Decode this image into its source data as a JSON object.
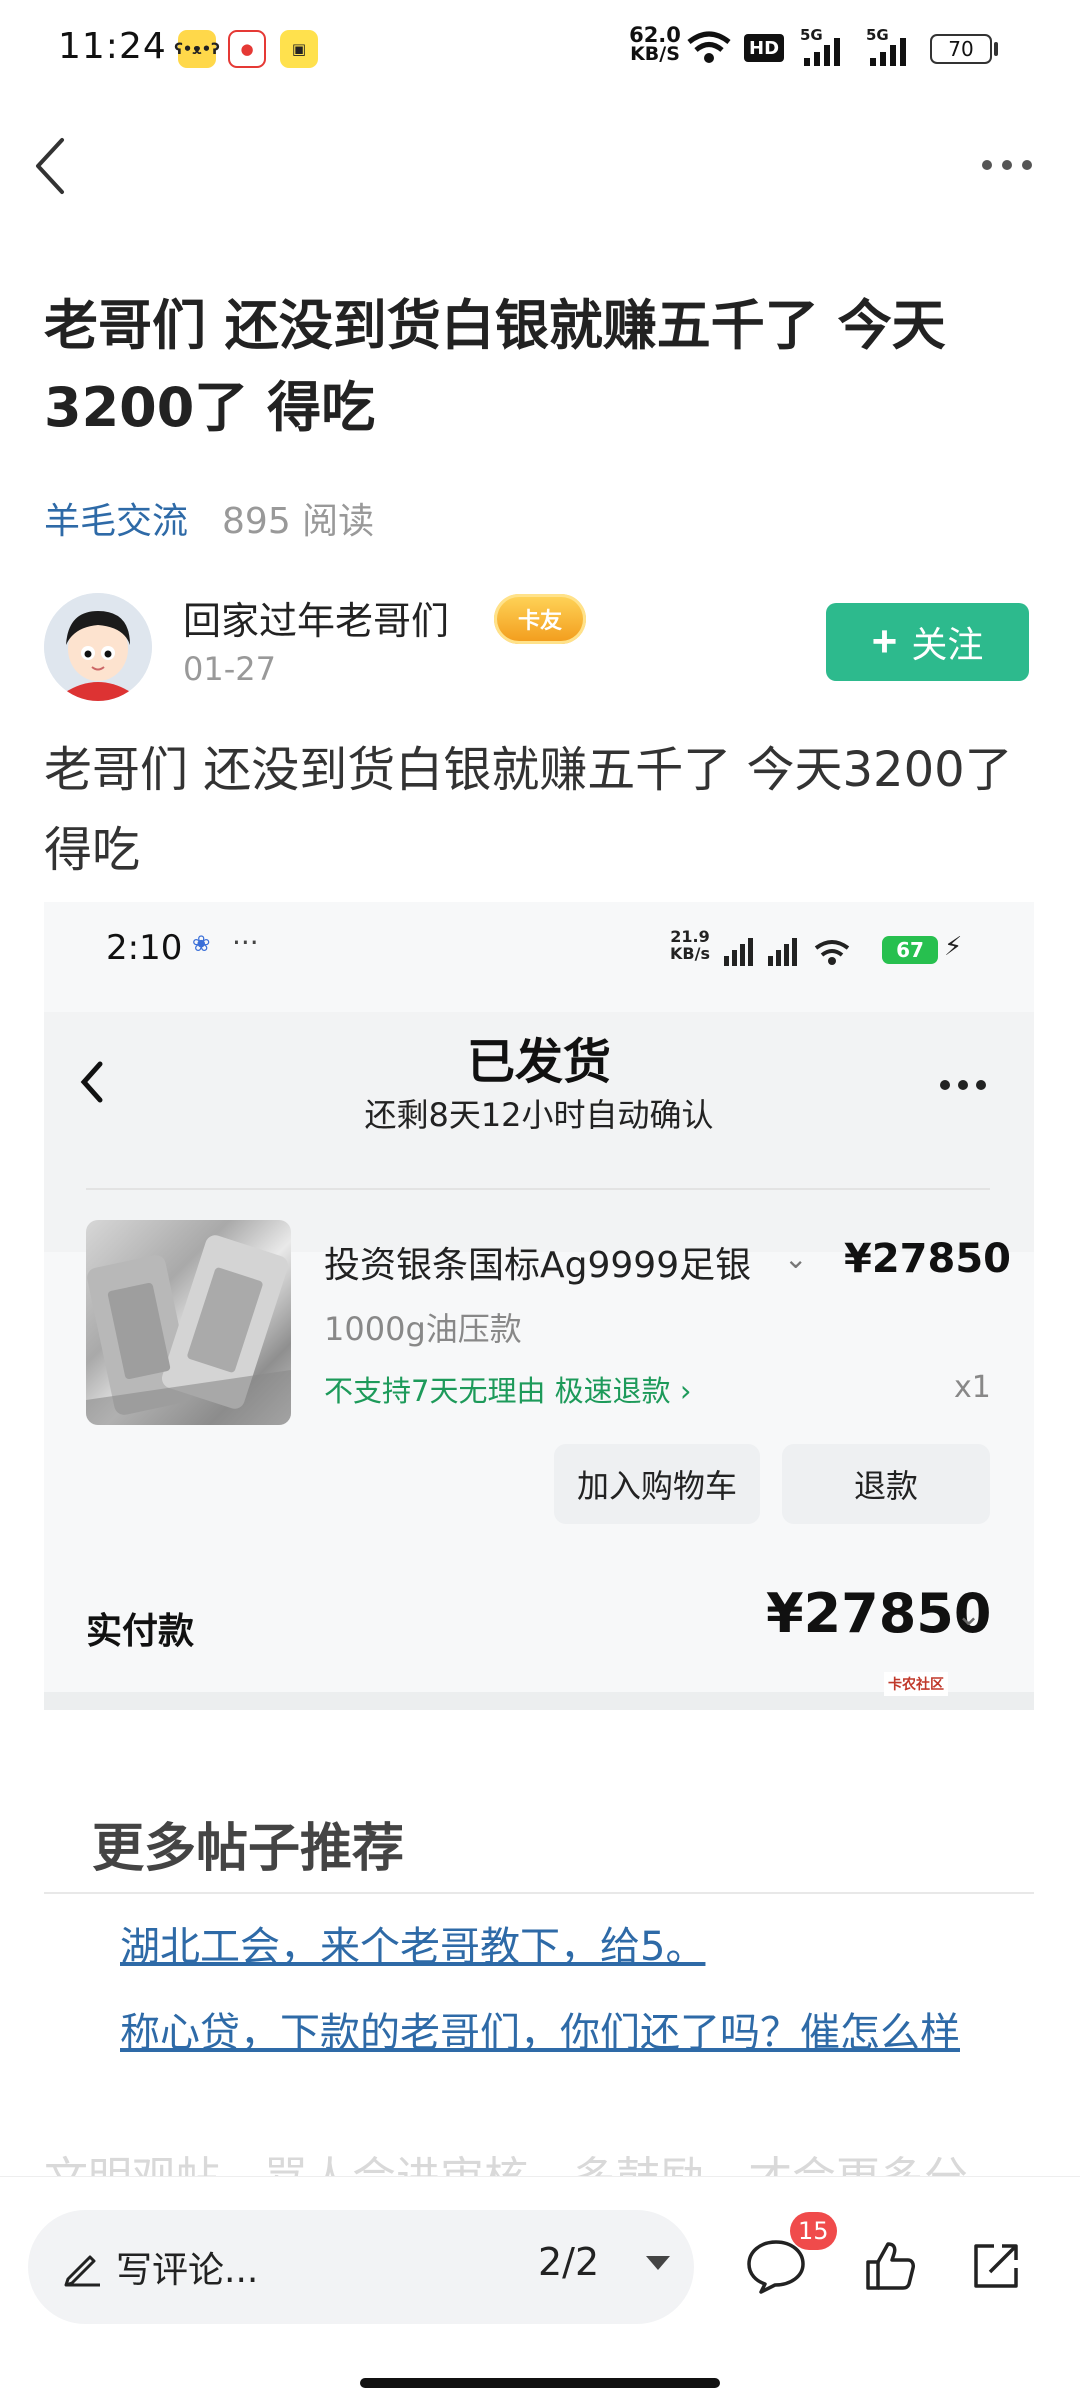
{
  "status_bar": {
    "time": "11:24",
    "net_speed_value": "62.0",
    "net_speed_unit": "KB/S",
    "hd_label": "HD",
    "network_1": "5G",
    "network_2": "5G",
    "battery": "70"
  },
  "post": {
    "title": "老哥们 还没到货白银就赚五千了 今天3200了 得吃",
    "category": "羊毛交流",
    "reads": "895 阅读",
    "author": "回家过年老哥们",
    "author_badge": "卡友",
    "date": "01-27",
    "follow_label": "关注",
    "body": "老哥们 还没到货白银就赚五千了 今天3200了 得吃"
  },
  "embedded_screenshot": {
    "time": "2:10",
    "dots": "···",
    "net_speed_value": "21.9",
    "net_speed_unit": "KB/s",
    "battery": "67",
    "order_status": "已发货",
    "auto_confirm": "还剩8天12小时自动确认",
    "product_name": "投资银条国标Ag9999足银",
    "product_price": "¥27850",
    "product_spec": "1000g油压款",
    "return_notice": "不支持7天无理由  极速退款 ›",
    "quantity": "x1",
    "add_to_cart": "加入购物车",
    "refund": "退款",
    "paid_label": "实付款",
    "paid_total": "¥27850",
    "watermark": "卡农社区"
  },
  "recommendations": {
    "heading": "更多帖子推荐",
    "links": [
      "湖北工会，来个老哥教下，给5。",
      "称心贷，下款的老哥们，你们还了吗？催怎么样"
    ]
  },
  "footer_notice": "文明观帖，骂人会进审核，多鼓励，才会更多分",
  "bottom_bar": {
    "comment_placeholder": "写评论...",
    "page_indicator": "2/2",
    "comment_count": "15"
  }
}
